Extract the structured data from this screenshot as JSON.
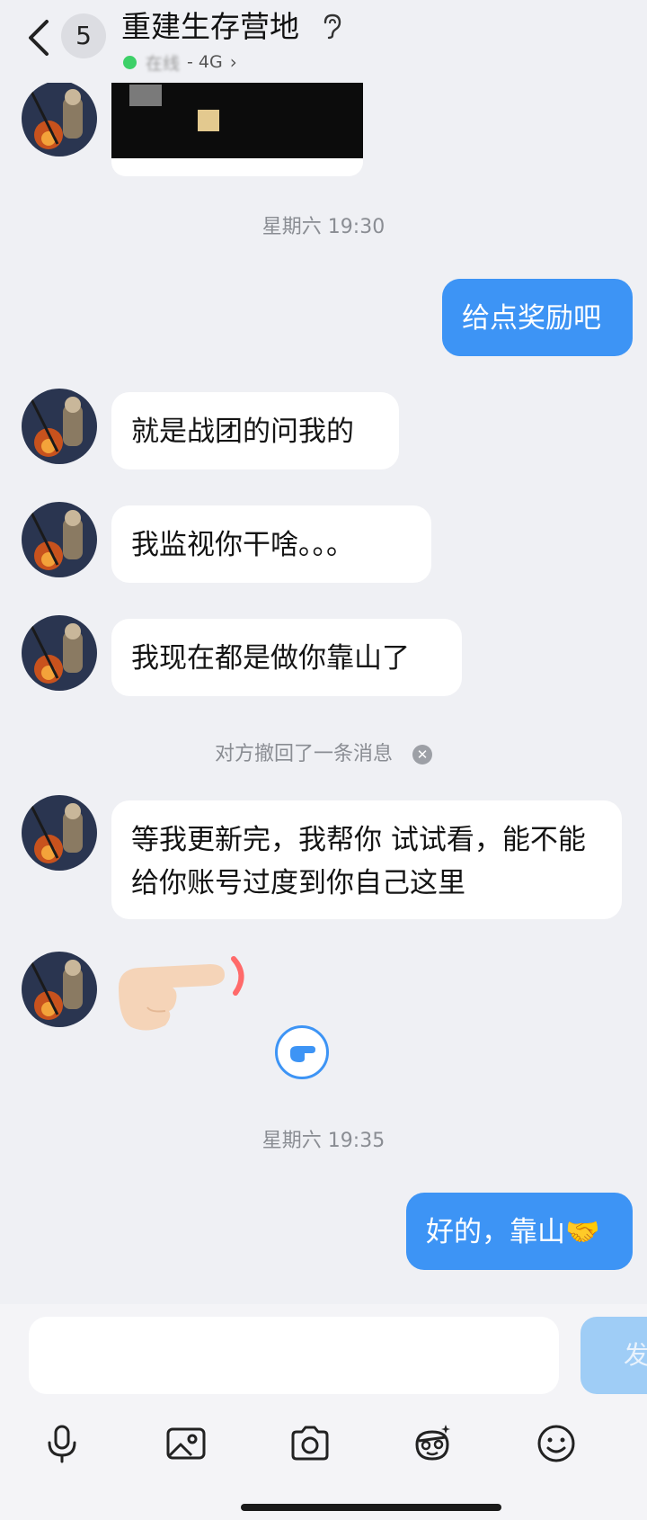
{
  "header": {
    "unread_count": "5",
    "title": "重建生存营地",
    "status_text": "在线",
    "network": "- 4G"
  },
  "messages": {
    "time1": "星期六 19:30",
    "me1": "给点奖励吧",
    "them1": "就是战团的问我的",
    "them2": "我监视你干啥。。。",
    "them3": "我现在都是做你靠山了",
    "recall_notice": "对方撤回了一条消息",
    "them4": "等我更新完，我帮你 试试看，能不能给你账号过度到你自己这里",
    "time2": "星期六 19:35",
    "me2": "好的，靠山",
    "me2_emoji": "🤝"
  },
  "input_bar": {
    "send_label": "发"
  },
  "colors": {
    "accent": "#3d94f5",
    "online": "#3dd068",
    "background": "#eff0f4"
  }
}
